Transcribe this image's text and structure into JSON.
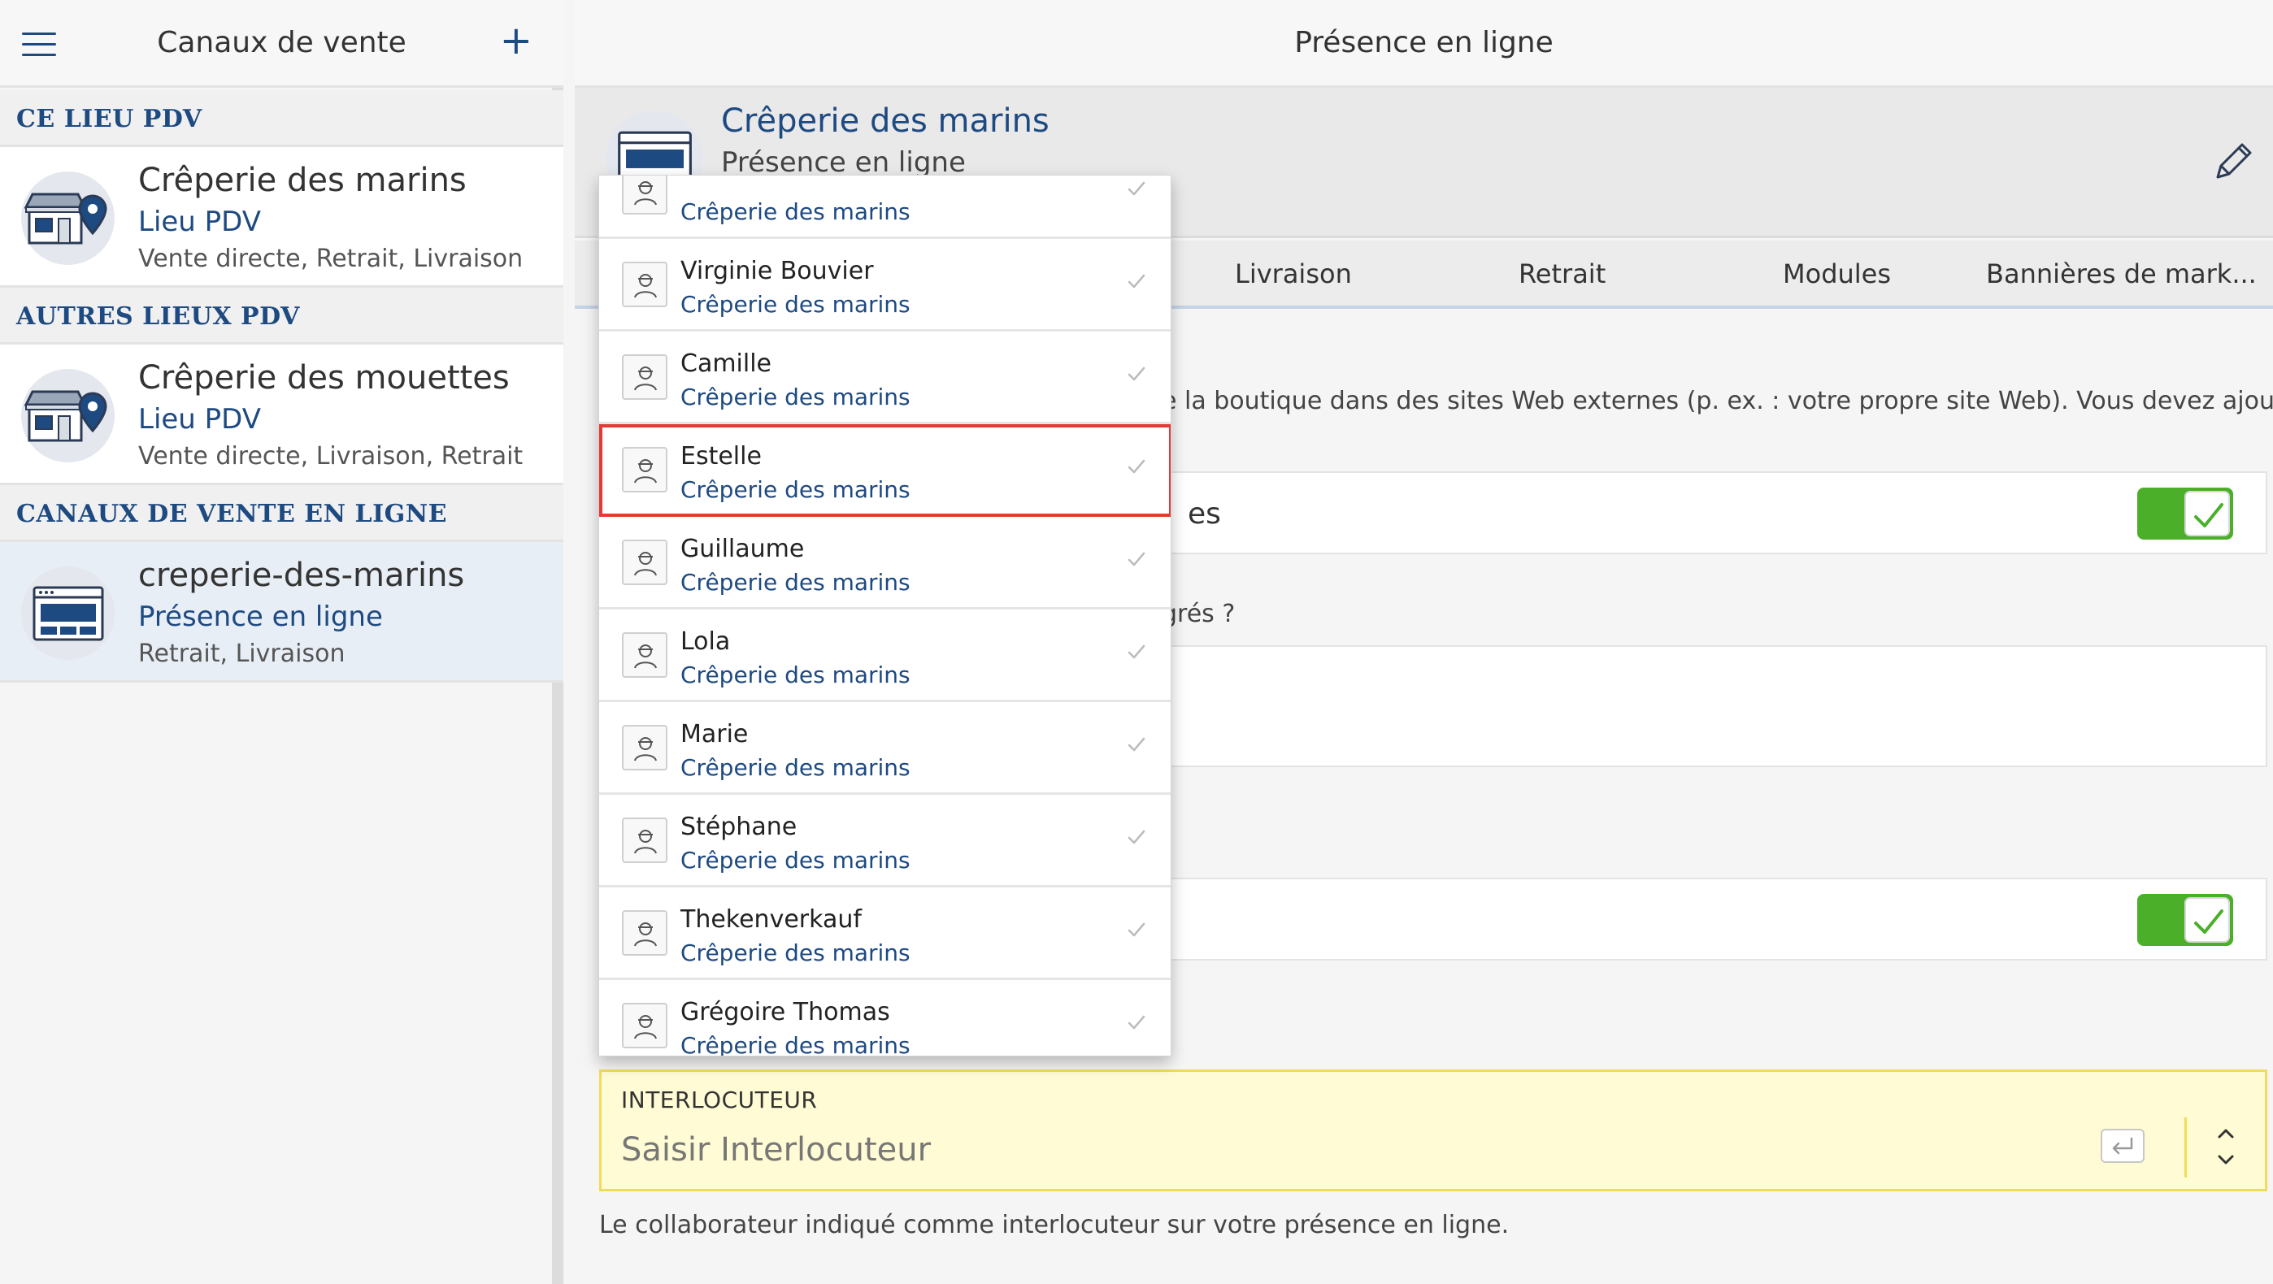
{
  "sidebar": {
    "title": "Canaux de vente",
    "sections": [
      {
        "label": "CE LIEU PDV"
      },
      {
        "label": "AUTRES LIEUX PDV"
      },
      {
        "label": "CANAUX DE VENTE EN LIGNE"
      }
    ],
    "items": [
      {
        "title": "Crêperie des marins",
        "subtitle": "Lieu PDV",
        "description": "Vente directe, Retrait, Livraison"
      },
      {
        "title": "Crêperie des mouettes",
        "subtitle": "Lieu PDV",
        "description": "Vente directe, Livraison, Retrait"
      },
      {
        "title": "creperie-des-marins",
        "subtitle": "Présence en ligne",
        "description": "Retrait, Livraison"
      }
    ]
  },
  "main": {
    "title": "Présence en ligne",
    "hero": {
      "title": "Crêperie des marins",
      "subtitle": "Présence en ligne"
    },
    "tabs": [
      "Livraison",
      "Retrait",
      "Modules",
      "Bannières de mark..."
    ],
    "text1": "e la boutique dans des sites Web externes (p. ex. : votre propre site Web). Vous devez ajouter un",
    "card1_label": "es",
    "text2": "grés ?",
    "toggle1_on": true,
    "toggle2_on": true,
    "contact": {
      "label": "INTERLOCUTEUR",
      "placeholder": "Saisir Interlocuteur",
      "help": "Le collaborateur indiqué comme interlocuteur sur votre présence en ligne."
    }
  },
  "dropdown": {
    "items": [
      {
        "name": "",
        "subtitle": "Crêperie des marins"
      },
      {
        "name": "Virginie Bouvier",
        "subtitle": "Crêperie des marins"
      },
      {
        "name": "Camille",
        "subtitle": "Crêperie des marins"
      },
      {
        "name": "Estelle",
        "subtitle": "Crêperie des marins",
        "selected": true
      },
      {
        "name": "Guillaume",
        "subtitle": "Crêperie des marins"
      },
      {
        "name": "Lola",
        "subtitle": "Crêperie des marins"
      },
      {
        "name": "Marie",
        "subtitle": "Crêperie des marins"
      },
      {
        "name": "Stéphane",
        "subtitle": "Crêperie des marins"
      },
      {
        "name": "Thekenverkauf",
        "subtitle": "Crêperie des marins"
      },
      {
        "name": "Grégoire Thomas",
        "subtitle": "Crêperie des marins"
      }
    ]
  },
  "colors": {
    "accent": "#1e4a82",
    "toggle_on": "#4caf2a",
    "highlight": "#e53935",
    "field_bg": "#fffbd4"
  },
  "icons": {
    "menu": "hamburger-icon",
    "add": "plus-icon",
    "store": "store-location-icon",
    "web": "website-icon",
    "edit": "pencil-icon",
    "user": "user-avatar-icon",
    "check": "checkmark-icon",
    "enter": "enter-key-icon",
    "stepper": "up-down-chevron-icon"
  }
}
